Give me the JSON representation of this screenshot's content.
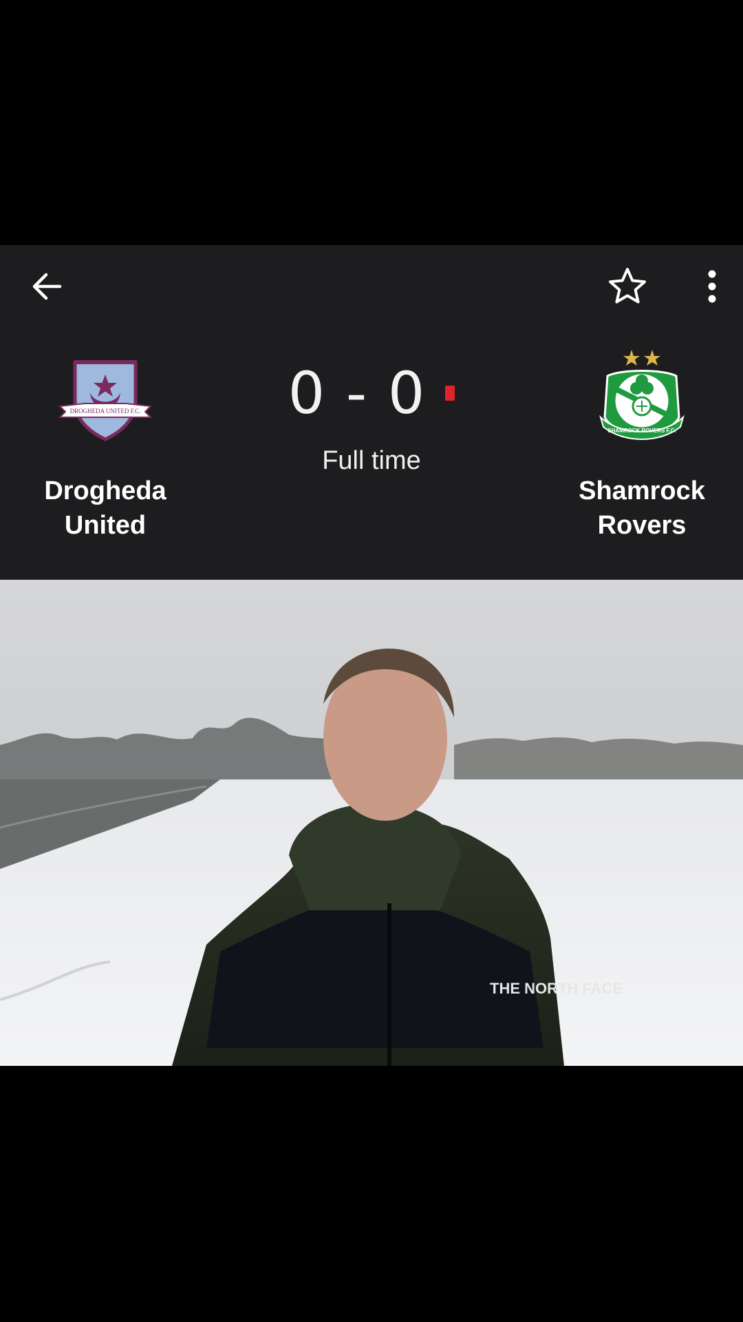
{
  "match": {
    "home_team": {
      "name": "Drogheda United",
      "crest_text": "DROGHEDA UNITED F.C."
    },
    "away_team": {
      "name": "Shamrock Rovers",
      "crest_text": "SHAMROCK ROVERS F.C."
    },
    "score": "0 - 0",
    "status": "Full time"
  },
  "toolbar": {
    "back_icon": "arrow-left-icon",
    "favorite_icon": "star-outline-icon",
    "more_icon": "more-vert-icon"
  },
  "video": {
    "logo_text": "THE NORTH FACE"
  },
  "colors": {
    "card_background": "#1d1c1e",
    "live_indicator": "#e0232f",
    "home_primary": "#7a2a5e",
    "home_secondary": "#9fb8de",
    "away_primary": "#1f9a3f"
  }
}
